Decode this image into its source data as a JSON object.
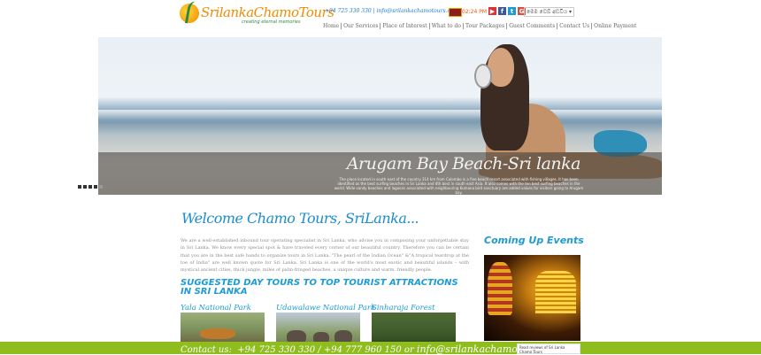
{
  "header": {
    "logo_text": "SrilankaChamoTours",
    "logo_tagline": "creating eternal memories",
    "contact": "+94 725 330 330 | info@srilankachamotours.com",
    "time": "02:24 PM",
    "language_label": "මෙම වෙබ් අඩවිය",
    "socials": [
      {
        "name": "youtube-icon",
        "glyph": "▶",
        "color": "#e03131"
      },
      {
        "name": "facebook-icon",
        "glyph": "f",
        "color": "#3b5998"
      },
      {
        "name": "twitter-icon",
        "glyph": "t",
        "color": "#1c9bd6"
      },
      {
        "name": "google-icon",
        "glyph": "G",
        "color": "#dd4b39"
      }
    ],
    "nav": [
      "Home",
      "Our Services",
      "Place of Interest",
      "What to do",
      "Tour Packages",
      "Guest Comments",
      "Contact Us",
      "Online Payment"
    ]
  },
  "slider": {
    "caption_title": "Arugam Bay Beach-Sri lanka",
    "caption_text": "The place located in south east of the country 314 km from Colombo is a fine beach resort associated with fishing villages. It has been identified as the best surfing beaches in Sri Lanka and 4th best in south east Asia. It also comes with the ten best surfing beaches in the world. Wide sandy beaches and lagoons associated with neighbouring Kumana bird sanctuary are added values for visitors going to Arugam bay.",
    "dots": 5,
    "active_dot": 4
  },
  "main": {
    "welcome": "Welcome Chamo Tours, SriLanka...",
    "intro": "We are a well-established inbound tour operating specialist in Sri Lanka, who advise you in composing your unforgettable stay in Sri Lanka. We know every special spot & have traveled every corner of our beautiful country. Therefore you can be certain that you are in the best safe hands to organize tours in Sri Lanka. \"The pearl of the Indian Ocean\" &\"A tropical teardrop at the toe of India\" are well known quote for Sri Lanka. Sri Lanka is one of the world's most exotic and beautiful islands – with mystical ancient cities, thick jungle, miles of palm-fringed beaches, a unique culture and warm, friendly people.",
    "suggested_heading": "SUGGESTED DAY TOURS TO TOP TOURIST ATTRACTIONS IN SRI LANKA",
    "tours": [
      {
        "title": "Yala National Park"
      },
      {
        "title": "Udawalawe National Park"
      },
      {
        "title": "Sinharaja Forest"
      }
    ]
  },
  "sidebar": {
    "events_heading": "Coming Up Events",
    "review_box": "Read reviews of Sri Lanka Chamo Tours"
  },
  "footer": {
    "contact_label": "Contact us:",
    "phones": "+94 725 330 330 / +94 777 960 150",
    "or": "or",
    "email": "info@srilankachamotours.com"
  }
}
